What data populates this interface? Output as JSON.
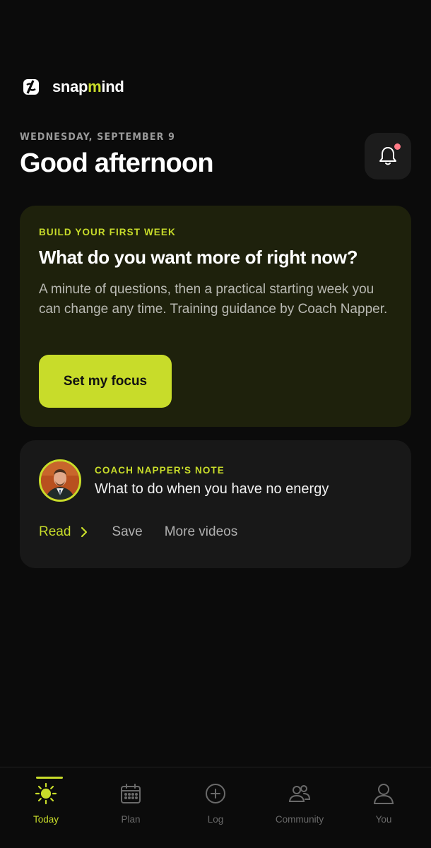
{
  "brand": {
    "name_prefix": "snap",
    "name_accent": "m",
    "name_suffix": "ind",
    "icon": "snapmind-logo-icon",
    "accent_color": "#c8dc2a"
  },
  "header": {
    "date": "WEDNESDAY, SEPTEMBER 9",
    "greeting": "Good afternoon",
    "notification_icon": "bell-icon",
    "has_unread": true
  },
  "focus_card": {
    "eyebrow": "BUILD YOUR FIRST WEEK",
    "title": "What do you want more of right now?",
    "body": "A minute of questions, then a practical starting week you can change any time. Training guidance by Coach Napper.",
    "button_label": "Set my focus"
  },
  "coach_note": {
    "eyebrow": "COACH NAPPER'S NOTE",
    "title": "What to do when you have no energy",
    "avatar_icon": "coach-avatar",
    "actions": {
      "read": "Read",
      "save": "Save",
      "more": "More videos"
    }
  },
  "nav": {
    "items": [
      {
        "label": "Today",
        "icon": "sun-icon",
        "active": true
      },
      {
        "label": "Plan",
        "icon": "calendar-icon",
        "active": false
      },
      {
        "label": "Log",
        "icon": "plus-circle-icon",
        "active": false
      },
      {
        "label": "Community",
        "icon": "people-icon",
        "active": false
      },
      {
        "label": "You",
        "icon": "person-icon",
        "active": false
      }
    ]
  }
}
